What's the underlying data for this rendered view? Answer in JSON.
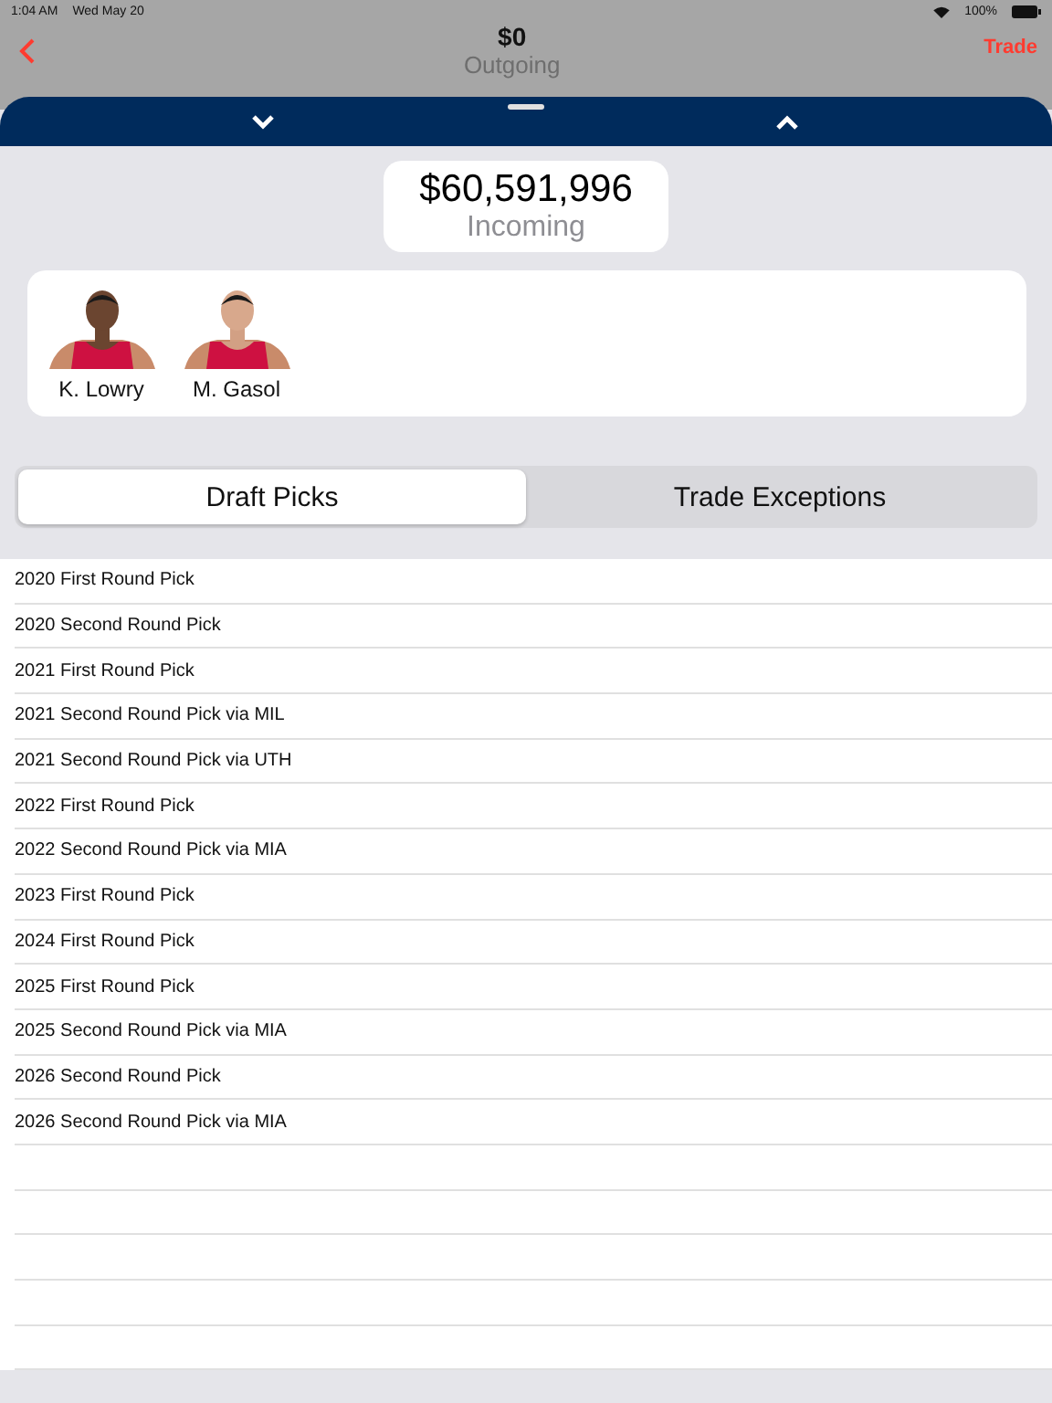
{
  "status_bar": {
    "time": "1:04 AM",
    "date": "Wed May 20",
    "battery": "100%"
  },
  "nav": {
    "amount": "$0",
    "label": "Outgoing",
    "action": "Trade"
  },
  "incoming": {
    "amount": "$60,591,996",
    "label": "Incoming"
  },
  "players": [
    {
      "name": "K. Lowry",
      "kind": "picture"
    },
    {
      "name": "M. Gasol",
      "kind": "picture"
    }
  ],
  "tabs": [
    {
      "label": "Draft Picks",
      "selected": true
    },
    {
      "label": "Trade Exceptions",
      "selected": false
    }
  ],
  "picks": [
    "2020 First Round Pick",
    "2020 Second Round Pick",
    "2021 First Round Pick",
    "2021 Second Round Pick via MIL",
    "2021 Second Round Pick via UTH",
    "2022 First Round Pick",
    "2022 Second Round Pick via MIA",
    "2023 First Round Pick",
    "2024 First Round Pick",
    "2025 First Round Pick",
    "2025 Second Round Pick via MIA",
    "2026 Second Round Pick",
    "2026 Second Round Pick via MIA"
  ]
}
